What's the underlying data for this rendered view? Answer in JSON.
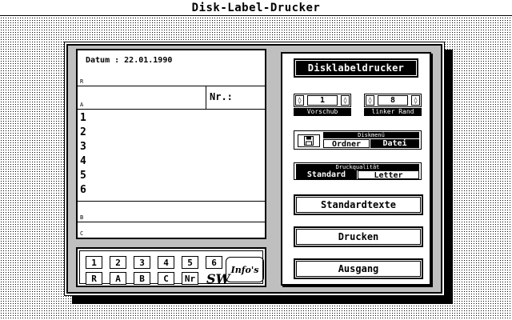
{
  "window": {
    "title": "Disk-Label-Drucker"
  },
  "label": {
    "date_text": "Datum : 22.01.1990",
    "section_letters": {
      "r": "R",
      "a": "A",
      "b": "B",
      "c": "C"
    },
    "nr_label": "Nr.:",
    "items": [
      "1",
      "2",
      "3",
      "4",
      "5",
      "6"
    ]
  },
  "toolbar": {
    "numbers": [
      "1",
      "2",
      "3",
      "4",
      "5",
      "6"
    ],
    "letters": [
      "R",
      "A",
      "B",
      "C",
      "Nr"
    ],
    "sw_logo": "SW",
    "infos_label": "Info's"
  },
  "panel": {
    "title": "Disklabeldrucker",
    "vorschub": {
      "value": "1",
      "caption": "Vorschub"
    },
    "rand": {
      "value": "8",
      "caption": "linker Rand"
    },
    "diskmenu": {
      "header": "Diskmenü",
      "options": [
        "Ordner",
        "Datei"
      ],
      "selected": "Datei",
      "icon": "floppy-disk-icon"
    },
    "quality": {
      "header": "Druckqualität",
      "options": [
        "Standard",
        "Letter"
      ],
      "selected": "Standard"
    },
    "buttons": {
      "standardtexte": "Standardtexte",
      "drucken": "Drucken",
      "ausgang": "Ausgang"
    }
  },
  "icons": {
    "left_arrow": "◊",
    "right_arrow": "◊"
  }
}
